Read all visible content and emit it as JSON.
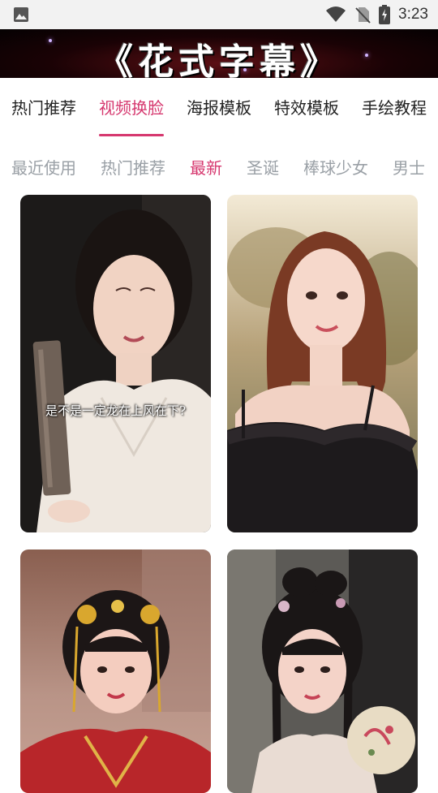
{
  "status_bar": {
    "time": "3:23",
    "icons": [
      "image-icon",
      "wifi-icon",
      "no-sim-icon",
      "battery-charging-icon"
    ]
  },
  "banner": {
    "title": "《花式字幕》"
  },
  "main_tabs": [
    {
      "label": "热门推荐",
      "active": false
    },
    {
      "label": "视频换脸",
      "active": true
    },
    {
      "label": "海报模板",
      "active": false
    },
    {
      "label": "特效模板",
      "active": false
    },
    {
      "label": "手绘教程",
      "active": false
    }
  ],
  "sub_tabs": [
    {
      "label": "最近使用",
      "active": false
    },
    {
      "label": "热门推荐",
      "active": false
    },
    {
      "label": "最新",
      "active": true
    },
    {
      "label": "圣诞",
      "active": false
    },
    {
      "label": "棒球少女",
      "active": false
    },
    {
      "label": "男士",
      "active": false
    }
  ],
  "cards": [
    {
      "caption": "是不是一定龙在上风在下?"
    },
    {
      "caption": ""
    },
    {
      "caption": ""
    },
    {
      "caption": ""
    }
  ],
  "colors": {
    "accent": "#d6386f",
    "inactive_subtab": "#9aa0a6"
  }
}
